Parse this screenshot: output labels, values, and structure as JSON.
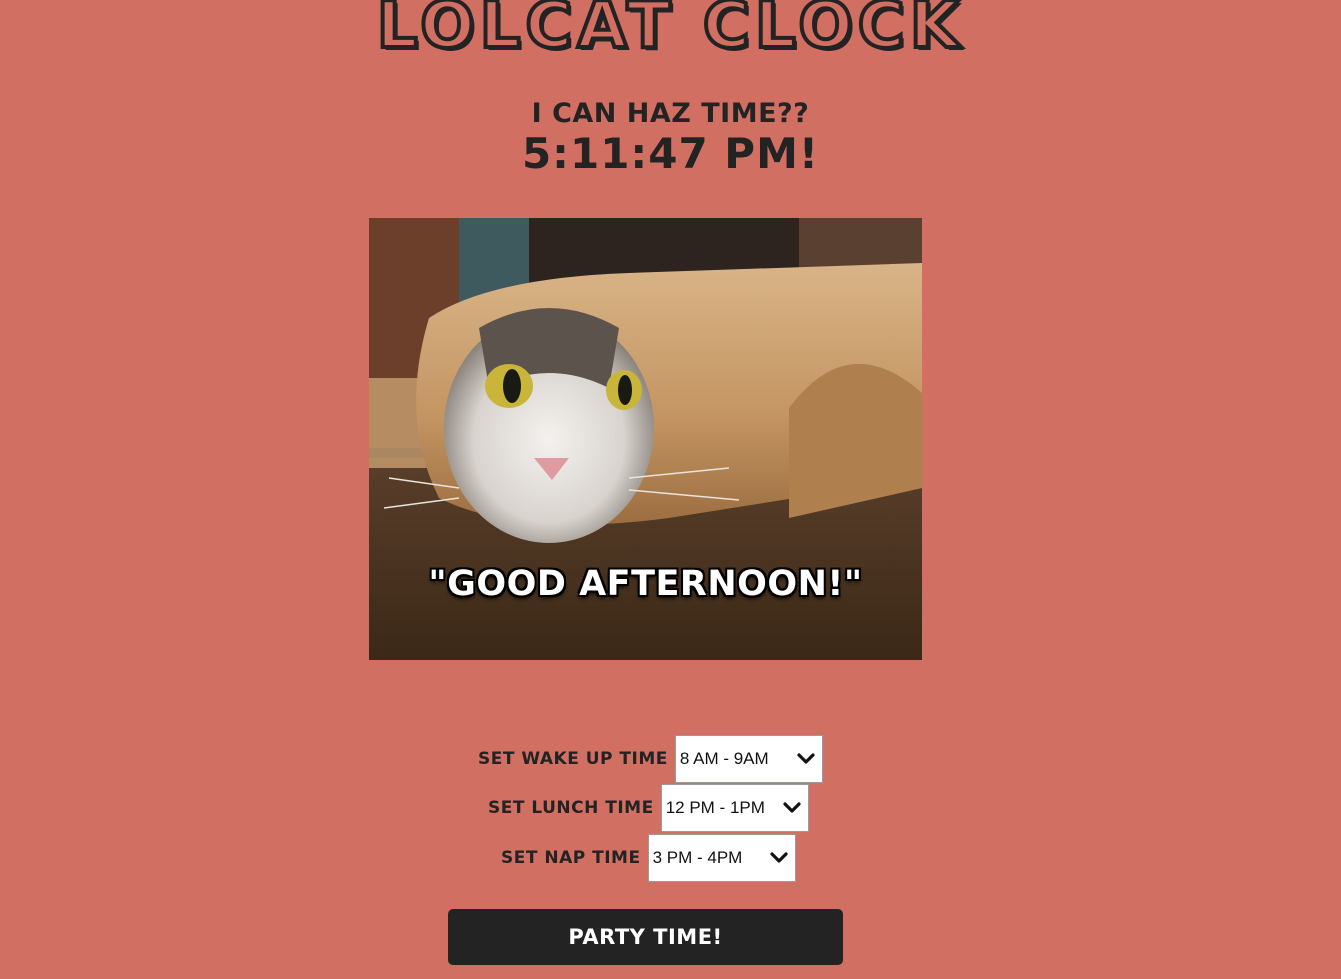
{
  "header": {
    "title": "LOLCAT CLOCK",
    "question": "I CAN HAZ TIME??",
    "clock": "5:11:47 PM!"
  },
  "image": {
    "caption": "\"GOOD AFTERNOON!\""
  },
  "settings": {
    "wake": {
      "label": "SET WAKE UP TIME",
      "value": "8 AM - 9AM"
    },
    "lunch": {
      "label": "SET LUNCH TIME",
      "value": "12 PM - 1PM"
    },
    "nap": {
      "label": "SET NAP TIME",
      "value": "3 PM - 4PM"
    }
  },
  "party_button": {
    "label": "PARTY TIME!"
  },
  "colors": {
    "background": "#d26f63",
    "text": "#232323",
    "button": "#232323"
  }
}
